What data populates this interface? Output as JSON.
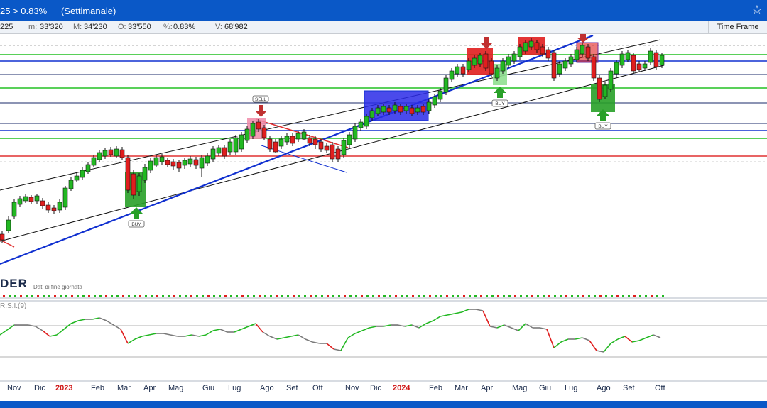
{
  "title": {
    "change": "25 > 0.83%",
    "period": "(Settimanale)"
  },
  "info": {
    "first": "225",
    "min_label": "m:",
    "min": "33'320",
    "max_label": "M:",
    "max": "34'230",
    "open_label": "O:",
    "open": "33'550",
    "pct_label": "%:",
    "pct": "0.83%",
    "vol_label": "V:",
    "vol": "68'982",
    "timeframe": "Time Frame"
  },
  "brand": {
    "name": "DER",
    "subtitle": "Dati di fine giornata"
  },
  "rsi": {
    "label": "R.S.I.(9)"
  },
  "signals": {
    "sell": "SELL",
    "buy1": "BUY",
    "buy2": "BUY",
    "buy3": "BUY"
  },
  "xaxis": [
    {
      "label": "Nov",
      "year": false
    },
    {
      "label": "Dic",
      "year": false
    },
    {
      "label": "2023",
      "year": true
    },
    {
      "label": "Feb",
      "year": false
    },
    {
      "label": "Mar",
      "year": false
    },
    {
      "label": "Apr",
      "year": false
    },
    {
      "label": "Mag",
      "year": false
    },
    {
      "label": "Giu",
      "year": false
    },
    {
      "label": "Lug",
      "year": false
    },
    {
      "label": "Ago",
      "year": false
    },
    {
      "label": "Set",
      "year": false
    },
    {
      "label": "Ott",
      "year": false
    },
    {
      "label": "Nov",
      "year": false
    },
    {
      "label": "Dic",
      "year": false
    },
    {
      "label": "2024",
      "year": true
    },
    {
      "label": "Feb",
      "year": false
    },
    {
      "label": "Mar",
      "year": false
    },
    {
      "label": "Apr",
      "year": false
    },
    {
      "label": "Mag",
      "year": false
    },
    {
      "label": "Giu",
      "year": false
    },
    {
      "label": "Lug",
      "year": false
    },
    {
      "label": "Ago",
      "year": false
    },
    {
      "label": "Set",
      "year": false
    },
    {
      "label": "Ott",
      "year": false
    }
  ],
  "colors": {
    "up": "#22b822",
    "down": "#e01e1e",
    "blue_line": "#1030d0",
    "title_bg": "#0a58c7"
  }
}
